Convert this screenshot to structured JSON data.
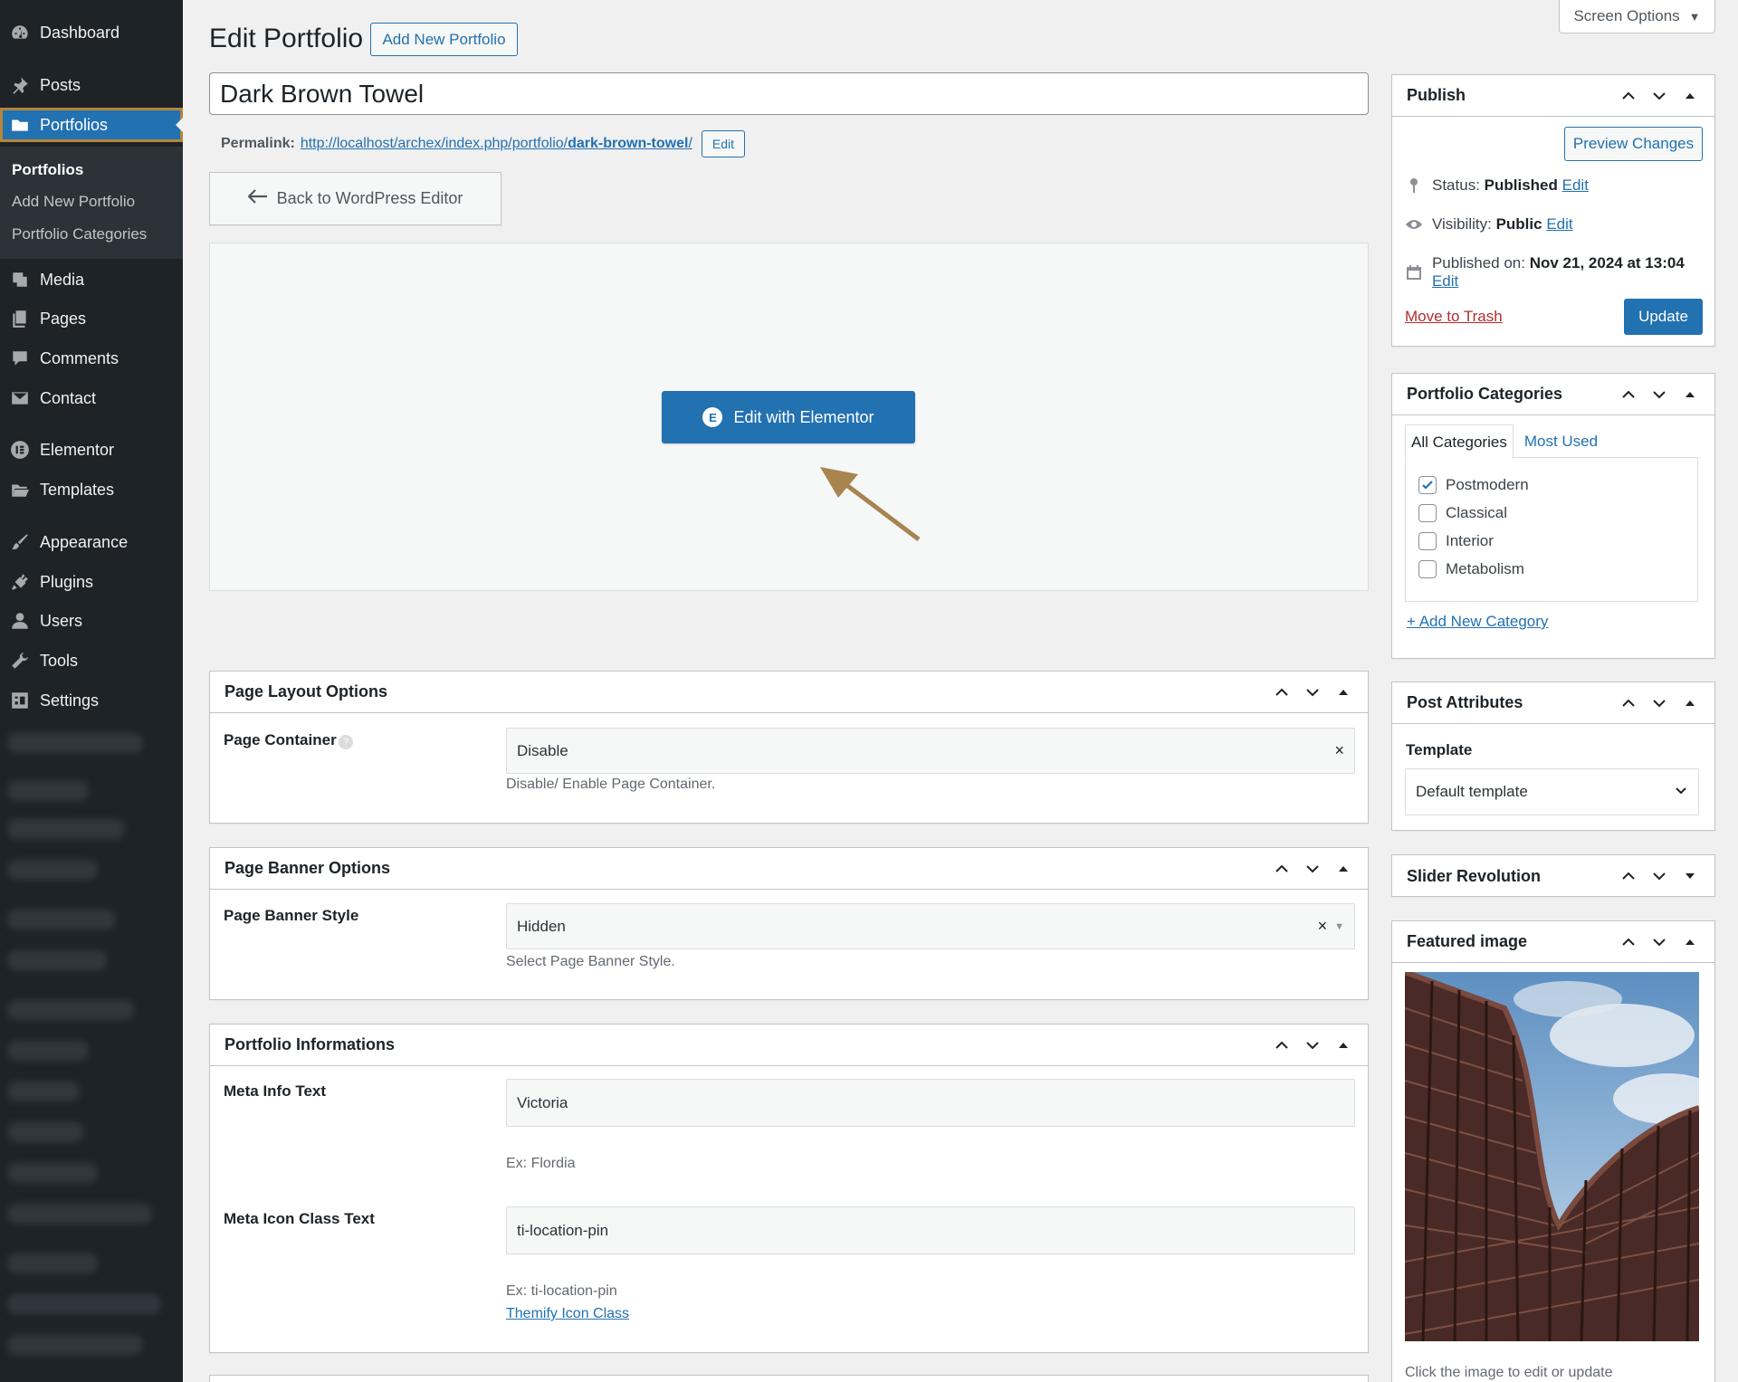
{
  "sidebar": {
    "items": [
      {
        "label": "Dashboard",
        "icon": "dashboard-icon"
      },
      {
        "label": "Posts",
        "icon": "pin-icon"
      },
      {
        "label": "Portfolios",
        "icon": "folder-icon"
      },
      {
        "label": "Media",
        "icon": "media-icon"
      },
      {
        "label": "Pages",
        "icon": "pages-icon"
      },
      {
        "label": "Comments",
        "icon": "comments-icon"
      },
      {
        "label": "Contact",
        "icon": "mail-icon"
      },
      {
        "label": "Elementor",
        "icon": "elementor-icon"
      },
      {
        "label": "Templates",
        "icon": "folder-open-icon"
      },
      {
        "label": "Appearance",
        "icon": "brush-icon"
      },
      {
        "label": "Plugins",
        "icon": "plugin-icon"
      },
      {
        "label": "Users",
        "icon": "user-icon"
      },
      {
        "label": "Tools",
        "icon": "wrench-icon"
      },
      {
        "label": "Settings",
        "icon": "settings-icon"
      }
    ],
    "submenu": [
      "Portfolios",
      "Add New Portfolio",
      "Portfolio Categories"
    ]
  },
  "header": {
    "title": "Edit Portfolio",
    "add_new": "Add New Portfolio",
    "screen_options": "Screen Options"
  },
  "post": {
    "title": "Dark Brown Towel",
    "permalink_label": "Permalink:",
    "permalink_base": "http://localhost/archex/index.php/portfolio/",
    "permalink_slug": "dark-brown-towel",
    "permalink_trail": "/",
    "permalink_edit": "Edit"
  },
  "editor": {
    "back_label": "Back to WordPress Editor",
    "elementor_label": "Edit with Elementor",
    "elementor_logo": "E"
  },
  "page_layout": {
    "title": "Page Layout Options",
    "container_label": "Page Container",
    "container_value": "Disable",
    "container_desc": "Disable/ Enable Page Container."
  },
  "page_banner": {
    "title": "Page Banner Options",
    "style_label": "Page Banner Style",
    "style_value": "Hidden",
    "style_desc": "Select Page Banner Style."
  },
  "portfolio_info": {
    "title": "Portfolio Informations",
    "meta_label": "Meta Info Text",
    "meta_value": "Victoria",
    "meta_desc": "Ex: Flordia",
    "icon_label": "Meta Icon Class Text",
    "icon_value": "ti-location-pin",
    "icon_desc": "Ex: ti-location-pin",
    "icon_link": "Themify Icon Class"
  },
  "publish": {
    "title": "Publish",
    "preview": "Preview Changes",
    "status_label": "Status:",
    "status_value": "Published",
    "visibility_label": "Visibility:",
    "visibility_value": "Public",
    "published_label": "Published on:",
    "published_value": "Nov 21, 2024 at 13:04",
    "edit": "Edit",
    "trash": "Move to Trash",
    "update": "Update"
  },
  "categories": {
    "title": "Portfolio Categories",
    "tab_all": "All Categories",
    "tab_most": "Most Used",
    "items": [
      {
        "label": "Postmodern",
        "checked": true
      },
      {
        "label": "Classical",
        "checked": false
      },
      {
        "label": "Interior",
        "checked": false
      },
      {
        "label": "Metabolism",
        "checked": false
      }
    ],
    "add_new": "+ Add New Category"
  },
  "attributes": {
    "title": "Post Attributes",
    "template_label": "Template",
    "template_value": "Default template"
  },
  "slider": {
    "title": "Slider Revolution"
  },
  "featured": {
    "title": "Featured image",
    "caption": "Click the image to edit or update"
  },
  "colors": {
    "primary": "#2271b1",
    "sidebar": "#1d2327",
    "highlight_outline": "#b5853a",
    "arrow": "#a8844f",
    "danger": "#b32d2e"
  }
}
